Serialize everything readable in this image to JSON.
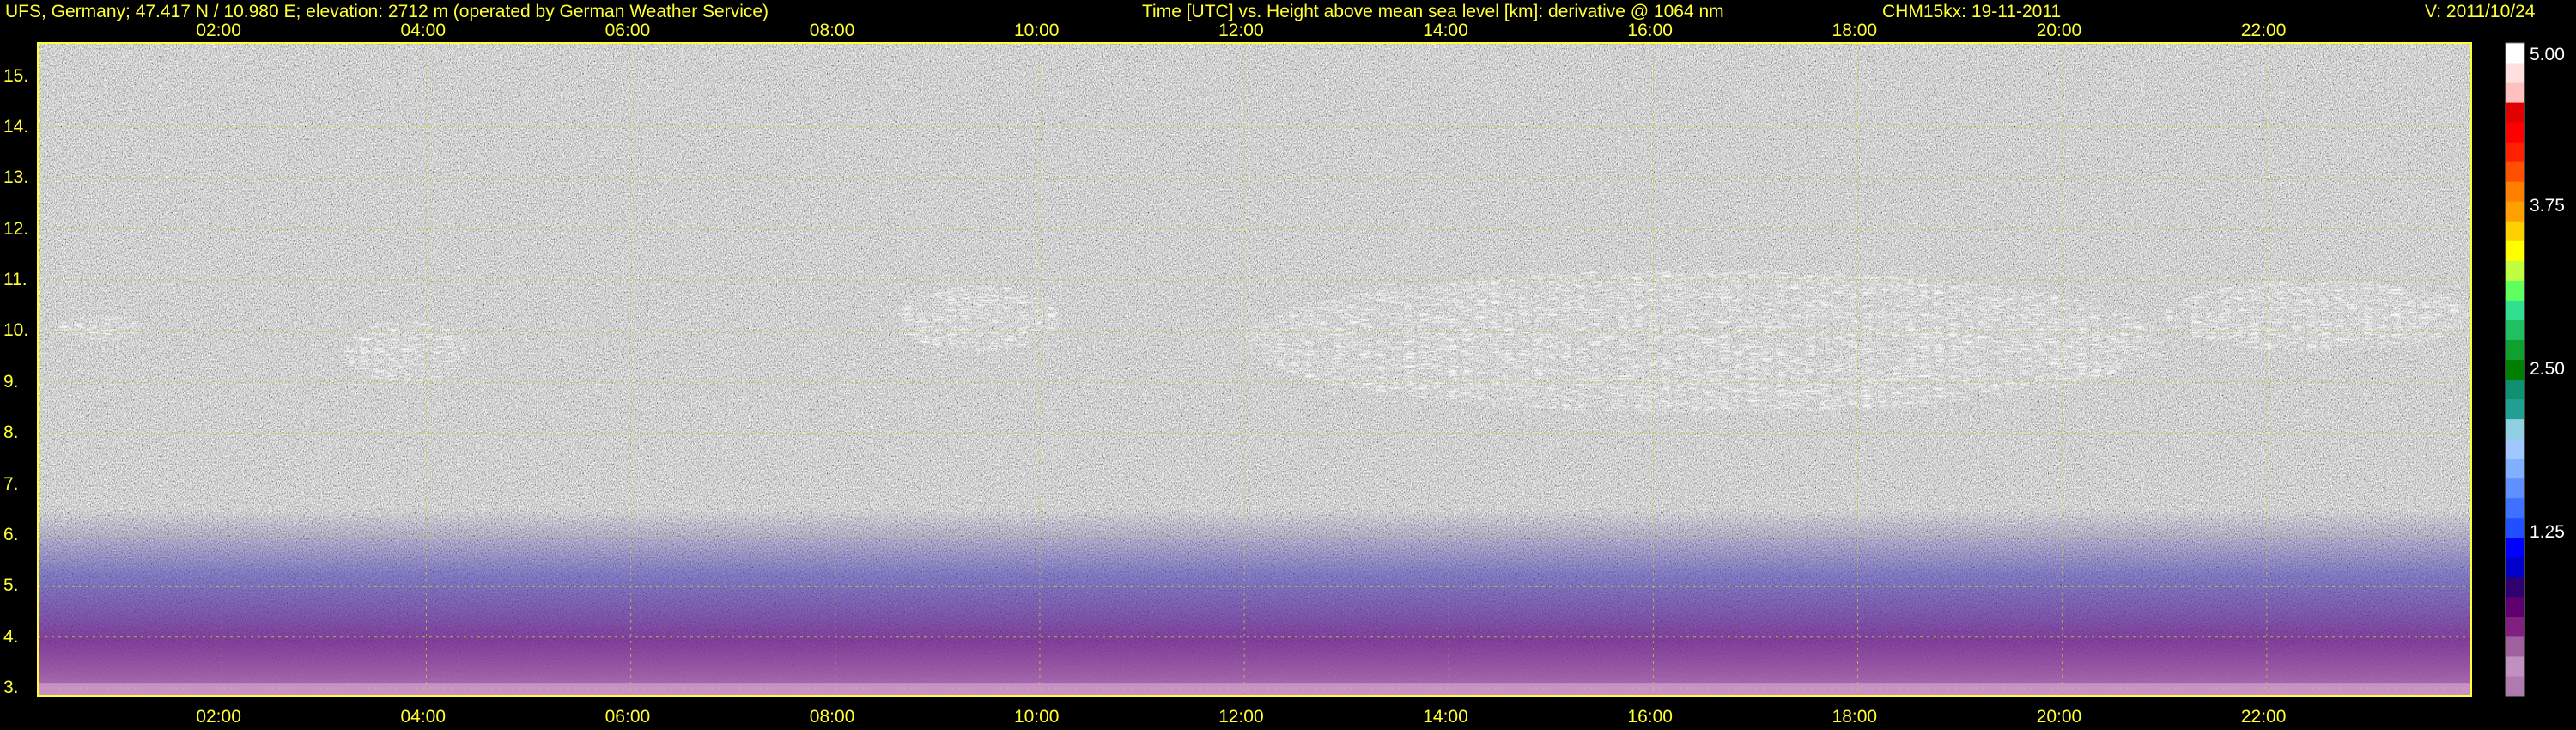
{
  "header": {
    "site": "UFS, Germany; 47.417 N / 10.980 E; elevation: 2712 m  (operated by German Weather Service)",
    "axes_desc": "Time [UTC] vs. Height above mean sea level [km]: derivative @ 1064 nm",
    "instrument": "CHM15kx: 19-11-2011",
    "version": "V: 2011/10/24"
  },
  "colors": {
    "text": "#ffff33",
    "grid": "#cccc33",
    "frame": "#ffff33",
    "background": "#000000"
  },
  "chart_data": {
    "type": "heatmap",
    "title": "",
    "xlabel": "",
    "ylabel": "",
    "x_ticks": [
      "02:00",
      "04:00",
      "06:00",
      "08:00",
      "10:00",
      "12:00",
      "14:00",
      "16:00",
      "18:00",
      "20:00",
      "22:00"
    ],
    "x_tick_hours": [
      2,
      4,
      6,
      8,
      10,
      12,
      14,
      16,
      18,
      20,
      22
    ],
    "xlim_hours": [
      0.2,
      24.0
    ],
    "y_ticks": [
      "3.",
      "4.",
      "5.",
      "6.",
      "7.",
      "8.",
      "9.",
      "10.",
      "11.",
      "12.",
      "13.",
      "14.",
      "15."
    ],
    "y_tick_values": [
      3,
      4,
      5,
      6,
      7,
      8,
      9,
      10,
      11,
      12,
      13,
      14,
      15
    ],
    "ylim_km": [
      2.85,
      15.65
    ],
    "grid": true,
    "colorbar": {
      "ticks": [
        "5.00",
        "3.75",
        "2.50",
        "1.25"
      ],
      "tick_values": [
        5.0,
        3.75,
        2.5,
        1.25
      ],
      "range": [
        0.0,
        5.0
      ],
      "colors": [
        "#b07ab0",
        "#c090c0",
        "#a060a0",
        "#802080",
        "#600070",
        "#300070",
        "#0000c8",
        "#0000ff",
        "#2050ff",
        "#4070ff",
        "#6090ff",
        "#80b0ff",
        "#a0c8ff",
        "#90d0e0",
        "#20a090",
        "#109070",
        "#008000",
        "#10a030",
        "#20c060",
        "#30e090",
        "#60ff60",
        "#c0ff40",
        "#ffff00",
        "#ffd000",
        "#ffa000",
        "#ff8000",
        "#ff5000",
        "#ff2000",
        "#ff0000",
        "#e00000",
        "#ffc0c0",
        "#ffe0e0",
        "#ffffff"
      ]
    },
    "features": [
      {
        "name": "cirrus-main",
        "x_hours": [
          12.0,
          21.0
        ],
        "y_km": [
          8.4,
          11.2
        ]
      },
      {
        "name": "cirrus-east",
        "x_hours": [
          21.0,
          24.0
        ],
        "y_km": [
          9.6,
          11.0
        ]
      },
      {
        "name": "cloud-patch-1",
        "x_hours": [
          3.2,
          4.4
        ],
        "y_km": [
          9.0,
          10.2
        ]
      },
      {
        "name": "cloud-patch-2",
        "x_hours": [
          0.4,
          1.2
        ],
        "y_km": [
          9.8,
          10.3
        ]
      },
      {
        "name": "cloud-patch-3",
        "x_hours": [
          8.6,
          10.2
        ],
        "y_km": [
          9.6,
          10.9
        ]
      },
      {
        "name": "boundary-layer",
        "x_hours": [
          0.2,
          24.0
        ],
        "y_km": [
          2.85,
          6.5
        ]
      }
    ]
  }
}
